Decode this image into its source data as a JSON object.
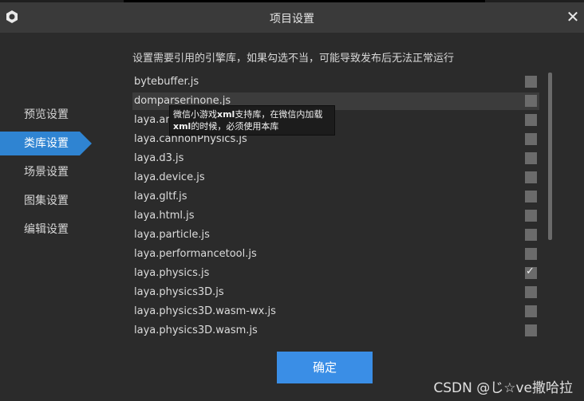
{
  "window": {
    "title": "项目设置",
    "close_glyph": "✕",
    "app_icon": "laya-logo-icon",
    "close_icon": "close-icon"
  },
  "sidebar": {
    "items": [
      {
        "label": "预览设置",
        "active": false
      },
      {
        "label": "类库设置",
        "active": true
      },
      {
        "label": "场景设置",
        "active": false
      },
      {
        "label": "图集设置",
        "active": false
      },
      {
        "label": "编辑设置",
        "active": false
      }
    ]
  },
  "main": {
    "hint": "设置需要引用的引擎库，如果勾选不当，可能导致发布后无法正常运行",
    "libraries": [
      {
        "name": "bytebuffer.js",
        "checked": false
      },
      {
        "name": "domparserinone.js",
        "checked": false
      },
      {
        "name": "laya.ani",
        "checked": false
      },
      {
        "name": "laya.cannonPhysics.js",
        "checked": false
      },
      {
        "name": "laya.d3.js",
        "checked": false
      },
      {
        "name": "laya.device.js",
        "checked": false
      },
      {
        "name": "laya.gltf.js",
        "checked": false
      },
      {
        "name": "laya.html.js",
        "checked": false
      },
      {
        "name": "laya.particle.js",
        "checked": false
      },
      {
        "name": "laya.performancetool.js",
        "checked": false
      },
      {
        "name": "laya.physics.js",
        "checked": true
      },
      {
        "name": "laya.physics3D.js",
        "checked": false
      },
      {
        "name": "laya.physics3D.wasm-wx.js",
        "checked": false
      },
      {
        "name": "laya.physics3D.wasm.js",
        "checked": false
      }
    ],
    "tooltip": {
      "line1_a": "微信小游戏",
      "line1_b": "xml",
      "line1_c": "支持库，在微信内加载",
      "line2_a": "xml",
      "line2_b": "的时候，必须使用本库"
    },
    "ok_label": "确定"
  },
  "watermark": "CSDN @じ☆ve撒哈拉",
  "colors": {
    "accent": "#2f84d2",
    "button": "#3a8ee6",
    "background": "#2b2b2b"
  }
}
